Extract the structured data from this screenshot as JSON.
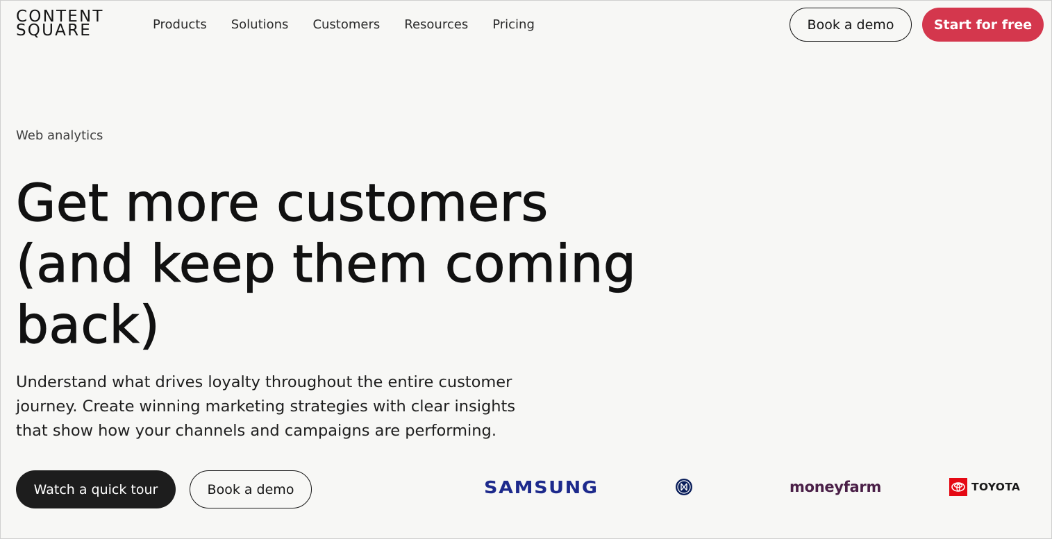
{
  "header": {
    "logo_line1": "CONTENT",
    "logo_line2": "SQUARE",
    "nav": [
      "Products",
      "Solutions",
      "Customers",
      "Resources",
      "Pricing"
    ],
    "book_demo_label": "Book a demo",
    "start_free_label": "Start for free"
  },
  "hero": {
    "eyebrow": "Web analytics",
    "headline_line1": "Get more customers",
    "headline_line2": "(and keep them coming",
    "headline_line3": "back)",
    "description": "Understand what drives loyalty throughout the entire customer journey. Create winning marketing strategies with clear insights that show how your channels and campaigns are performing.",
    "watch_tour_label": "Watch a quick tour",
    "book_demo_label": "Book a demo"
  },
  "customer_logos": {
    "samsung": "SAMSUNG",
    "inter": "inter-logo",
    "moneyfarm": "moneyfarm",
    "toyota": "TOYOTA"
  },
  "colors": {
    "background": "#f7f7f5",
    "accent_red": "#d4374d",
    "dark_button": "#1d1d1d",
    "samsung_blue": "#1d2a8c",
    "moneyfarm_purple": "#4a1f47",
    "toyota_red": "#e50914"
  }
}
